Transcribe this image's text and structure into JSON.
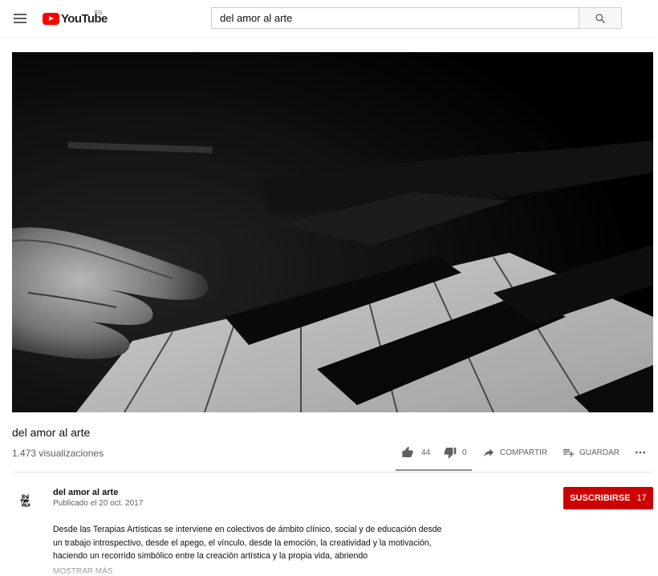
{
  "header": {
    "logo_text": "YouTube",
    "country_code": "ES",
    "search_value": "del amor al arte"
  },
  "video": {
    "title": "del amor al arte",
    "views": "1.473 visualizaciones",
    "likes": "44",
    "dislikes": "0",
    "share_label": "COMPARTIR",
    "save_label": "GUARDAR",
    "like_ratio": 1.0
  },
  "owner": {
    "channel_name": "del amor al arte",
    "published": "Publicado el 20 oct. 2017",
    "subscribe_label": "SUSCRIBIRSE",
    "subscriber_count": "17",
    "avatar_text": "del amor al arte"
  },
  "description": {
    "text": "Desde las Terapias Artísticas se interviene en colectivos de ámbito clínico, social y de educación desde un trabajo introspectivo, desde el apego, el vínculo, desde la emoción, la creatividad y la motivación, haciendo un recorrido simbólico entre la creación artística y la propia vida, abriendo",
    "show_more_label": "MOSTRAR MÁS"
  },
  "colors": {
    "brand_red": "#ff0000",
    "subscribe_red": "#cc0000",
    "secondary_text": "#606060"
  },
  "icons": [
    "menu-icon",
    "youtube-logo-icon",
    "search-icon",
    "thumb-up-icon",
    "thumb-down-icon",
    "share-icon",
    "playlist-add-icon",
    "more-icon"
  ]
}
